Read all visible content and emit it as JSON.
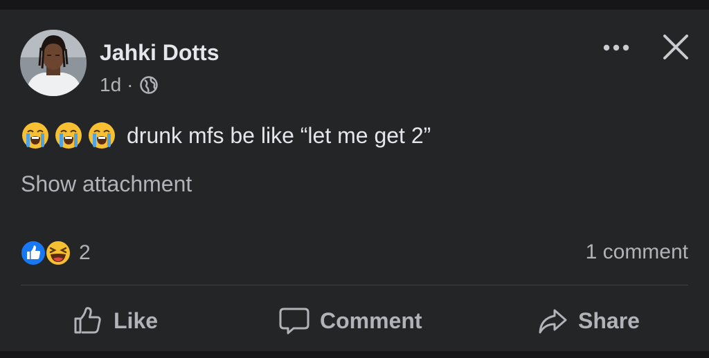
{
  "post": {
    "author_name": "Jahki Dotts",
    "time": "1d",
    "separator": "·",
    "audience_icon": "globe-icon",
    "emojis": [
      "loudly-crying-face",
      "loudly-crying-face",
      "loudly-crying-face"
    ],
    "body": "drunk mfs be like “let me get 2”",
    "show_attachment": "Show attachment",
    "reaction_icons": [
      "like-reaction",
      "haha-reaction"
    ],
    "reaction_count": "2",
    "comment_count": "1 comment"
  },
  "header_controls": {
    "more_icon": "more-options-icon",
    "close_icon": "close-icon"
  },
  "actions": {
    "like_label": "Like",
    "comment_label": "Comment",
    "share_label": "Share"
  },
  "colors": {
    "background": "#242526",
    "outer_background": "#161618",
    "primary_text": "#e4e6eb",
    "secondary_text": "#b0b3b8",
    "like_blue": "#1877f2",
    "emoji_yellow": "#f7c033"
  }
}
